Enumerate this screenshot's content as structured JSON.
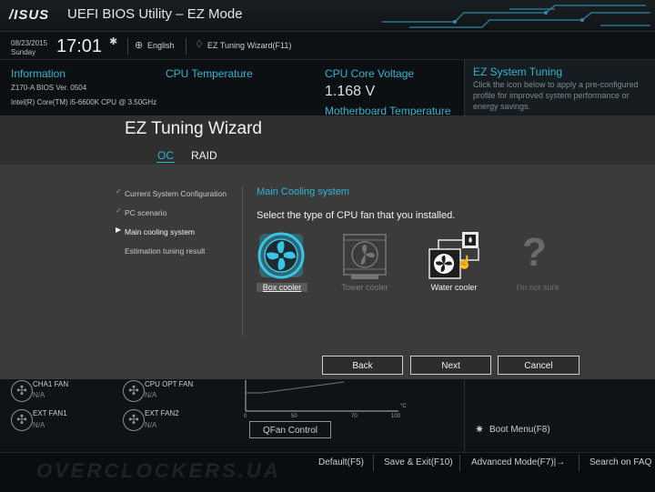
{
  "header": {
    "logo": "/ISUS",
    "title": "UEFI BIOS Utility – EZ Mode"
  },
  "datetime": {
    "date": "08/23/2015",
    "day": "Sunday",
    "time": "17:01"
  },
  "toolbar": {
    "language": "English",
    "wizard_link": "EZ Tuning Wizard(F11)"
  },
  "info": {
    "heading": "Information",
    "line1": "Z170-A   BIOS Ver. 0504",
    "line2": "Intel(R) Core(TM) i5-6600K CPU @ 3.50GHz"
  },
  "cpu_temp": {
    "heading": "CPU Temperature"
  },
  "cpu_voltage": {
    "heading": "CPU Core Voltage",
    "value": "1.168 V",
    "mb_temp_heading": "Motherboard Temperature"
  },
  "ez_system_tuning": {
    "heading": "EZ System Tuning",
    "desc": "Click the icon below to apply a pre-configured profile for improved system performance or energy savings."
  },
  "wizard": {
    "title": "EZ Tuning Wizard",
    "tabs": [
      {
        "label": "OC",
        "active": true
      },
      {
        "label": "RAID",
        "active": false
      }
    ],
    "steps": [
      {
        "label": "Current System Configuration",
        "state": "done"
      },
      {
        "label": "PC scenario",
        "state": "done"
      },
      {
        "label": "Main cooling system",
        "state": "current"
      },
      {
        "label": "Estimation tuning result",
        "state": "pending"
      }
    ],
    "section_heading": "Main Cooling system",
    "prompt": "Select the type of CPU fan that you installed.",
    "coolers": [
      {
        "label": "Box cooler",
        "icon": "box-cooler-icon",
        "state": "selected"
      },
      {
        "label": "Tower cooler",
        "icon": "tower-cooler-icon",
        "state": "disabled"
      },
      {
        "label": "Water cooler",
        "icon": "water-cooler-icon",
        "state": "hover"
      },
      {
        "label": "I'm not sure",
        "icon": "question-icon",
        "state": "disabled"
      }
    ],
    "buttons": {
      "back": "Back",
      "next": "Next",
      "cancel": "Cancel"
    }
  },
  "fans": [
    {
      "name": "CHA1 FAN",
      "value": "N/A"
    },
    {
      "name": "CPU OPT FAN",
      "value": "N/A"
    },
    {
      "name": "EXT FAN1",
      "value": "N/A"
    },
    {
      "name": "EXT FAN2",
      "value": "N/A"
    }
  ],
  "fan_graph": {
    "ticks": [
      "0",
      "50",
      "70",
      "100"
    ],
    "unit": "°C"
  },
  "qfan_button": "QFan Control",
  "boot_menu": "Boot Menu(F8)",
  "footer": {
    "default": "Default(F5)",
    "save_exit": "Save & Exit(F10)",
    "advanced": "Advanced Mode(F7)|→",
    "search": "Search on FAQ"
  },
  "watermark": "OVERCLOCKERS.UA",
  "colors": {
    "accent": "#2fb5cf",
    "modal_bg": "#3b3b3b"
  }
}
